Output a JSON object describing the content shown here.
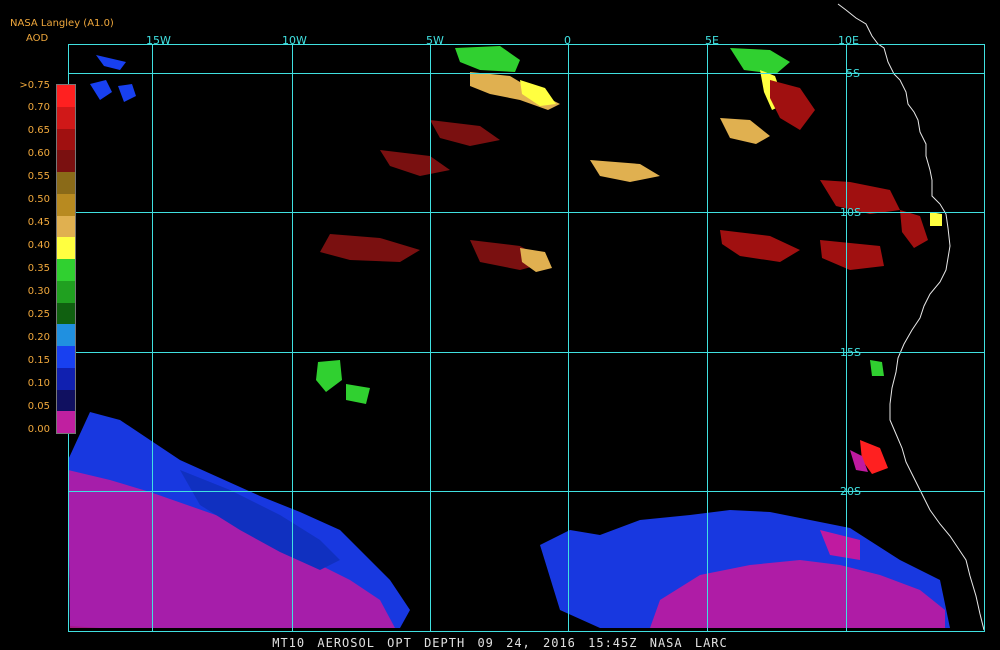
{
  "header": {
    "title": "NASA Langley (A1.0)",
    "variable": "AOD"
  },
  "legend": {
    "ticks": [
      ">0.75",
      "0.70",
      "0.65",
      "0.60",
      "0.55",
      "0.50",
      "0.45",
      "0.40",
      "0.35",
      "0.30",
      "0.25",
      "0.20",
      "0.15",
      "0.10",
      "0.05",
      "0.00"
    ],
    "colors": [
      "#ff2020",
      "#d01818",
      "#a01010",
      "#7a1010",
      "#8a6a18",
      "#b88a20",
      "#e0b050",
      "#ffff40",
      "#30d030",
      "#20a020",
      "#106010",
      "#2090e0",
      "#1840f0",
      "#1020b0",
      "#101060",
      "#c020a0"
    ]
  },
  "grid": {
    "lon_labels": [
      "15W",
      "10W",
      "5W",
      "0",
      "5E",
      "10E"
    ],
    "lat_labels": [
      "5S",
      "10S",
      "15S",
      "20S"
    ],
    "color": "#40e0e0"
  },
  "footer": {
    "product": "MT10",
    "field": "AEROSOL OPT DEPTH",
    "datetime": "09 24, 2016 15:45Z",
    "source": "NASA LARC"
  }
}
